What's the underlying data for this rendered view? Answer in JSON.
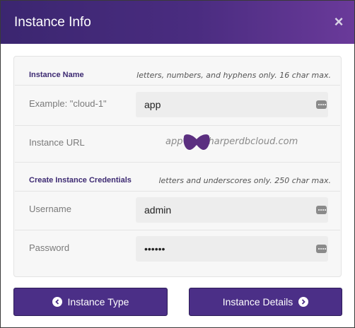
{
  "header": {
    "title": "Instance Info",
    "close_icon": "×"
  },
  "instance_name": {
    "section_title": "Instance Name",
    "hint": "letters, numbers, and hyphens only. 16 char max.",
    "label": "Example: \"cloud-1\"",
    "value": "app"
  },
  "instance_url": {
    "label": "Instance URL",
    "value_prefix": "app",
    "value_suffix": "harperdbcloud.com"
  },
  "credentials": {
    "section_title": "Create Instance Credentials",
    "hint": "letters and underscores only. 250 char max.",
    "username_label": "Username",
    "username_value": "admin",
    "password_label": "Password",
    "password_value": "••••••"
  },
  "footer": {
    "back_label": "Instance Type",
    "next_label": "Instance Details"
  },
  "colors": {
    "header": "#4a2c80",
    "button": "#4b2f87",
    "redaction": "#5b2f80"
  }
}
